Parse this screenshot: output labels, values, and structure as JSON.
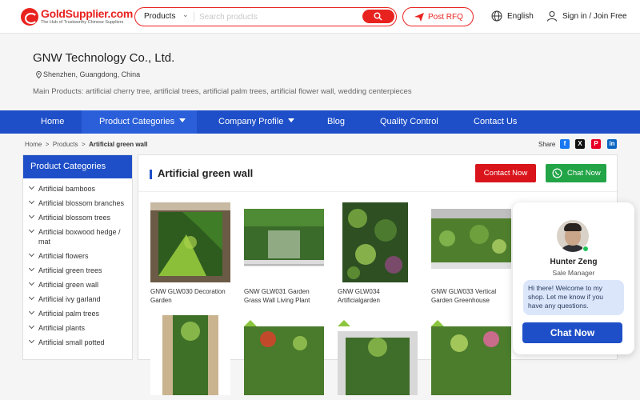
{
  "header": {
    "logo_text": "GoldSupplier.com",
    "logo_tagline": "The Hub of Trustworthy Chinese Suppliers",
    "search_category": "Products",
    "search_placeholder": "Search products",
    "post_rfq": "Post RFQ",
    "language": "English",
    "signin": "Sign in / Join Free"
  },
  "company": {
    "name": "GNW Technology Co., Ltd.",
    "location": "Shenzhen, Guangdong, China",
    "main_products": "Main Products: artificial cherry tree, artificial trees, artificial palm trees, artificial flower wall, wedding centerpieces"
  },
  "nav": {
    "items": [
      "Home",
      "Product Categories",
      "Company Profile",
      "Blog",
      "Quality Control",
      "Contact Us"
    ]
  },
  "breadcrumb": {
    "home": "Home",
    "sep": ">",
    "products": "Products",
    "current": "Artificial green wall"
  },
  "share": {
    "label": "Share",
    "icons": [
      "facebook-icon",
      "x-twitter-icon",
      "pinterest-icon",
      "linkedin-icon"
    ]
  },
  "sidebar": {
    "title": "Product Categories",
    "items": [
      "Artificial bamboos",
      "Artificial blossom branches",
      "Artificial blossom trees",
      "Artificial boxwood hedge / mat",
      "Artificial flowers",
      "Artificial green trees",
      "Artificial green wall",
      "Artificial ivy garland",
      "Artificial palm trees",
      "Artificial plants",
      "Artificial small potted"
    ]
  },
  "main": {
    "title": "Artificial green wall",
    "contact_now": "Contact Now",
    "chat_now": "Chat Now",
    "products": [
      {
        "name": "GNW GLW030 Decoration Garden"
      },
      {
        "name": "GNW GLW031 Garden Grass Wall Living Plant"
      },
      {
        "name": "GNW GLW034 Artificialgarden"
      },
      {
        "name": "GNW GLW033 Vertical Garden Greenhouse"
      },
      {
        "name": ""
      },
      {
        "name": ""
      },
      {
        "name": ""
      },
      {
        "name": ""
      },
      {
        "name": ""
      }
    ]
  },
  "chat_widget": {
    "agent_name": "Hunter Zeng",
    "agent_role": "Sale Manager",
    "message": "Hi there! Welcome to my shop. Let me know if you have any questions.",
    "button": "Chat Now"
  },
  "colors": {
    "brand_red": "#e8231f",
    "nav_blue": "#1e4fc8",
    "chat_green": "#22a447",
    "contact_red": "#d9141b"
  }
}
